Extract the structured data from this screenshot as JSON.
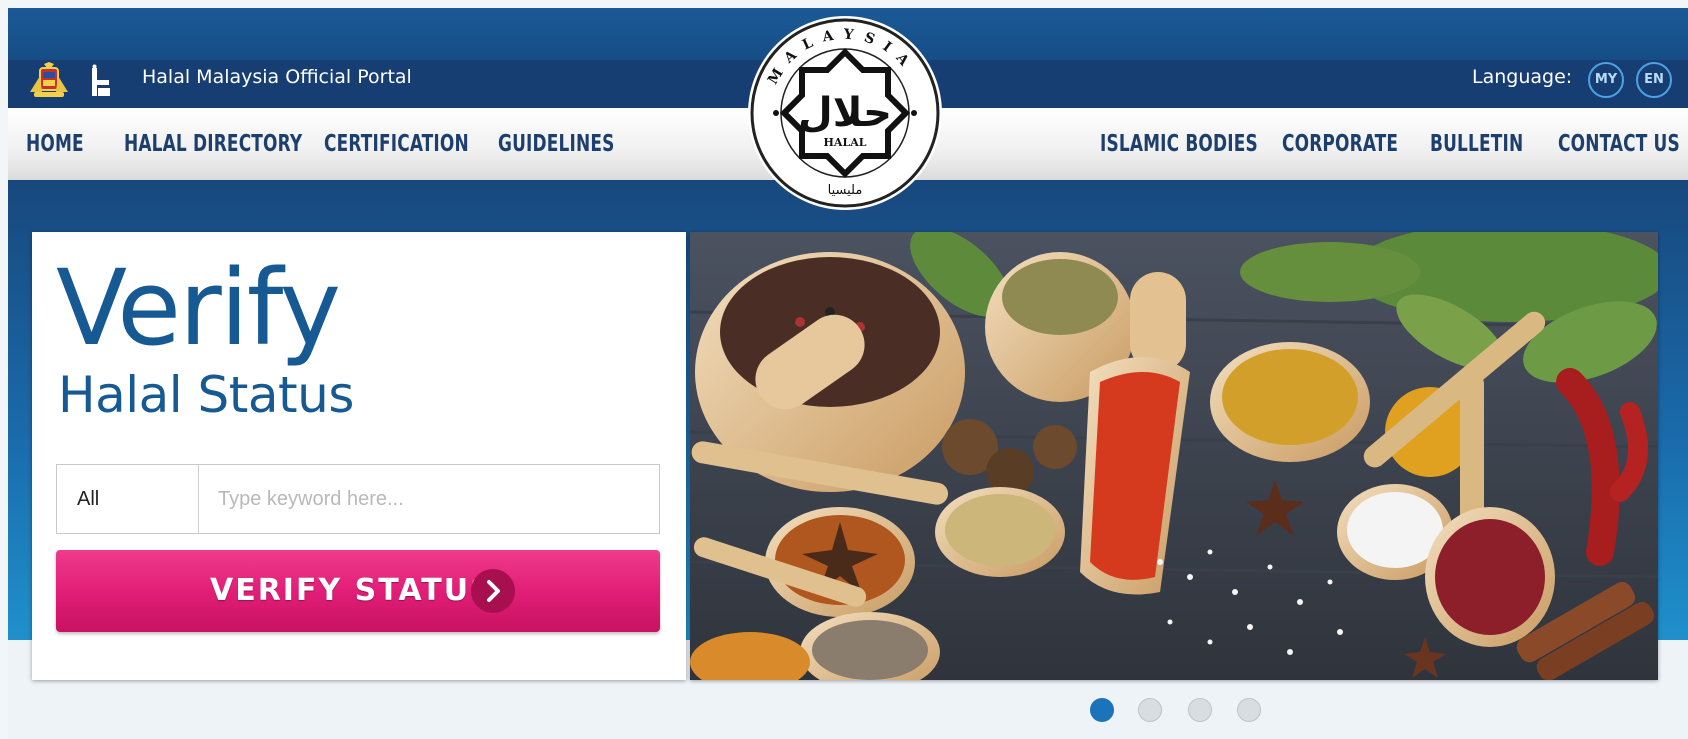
{
  "header": {
    "portal_title": "Halal Malaysia Official Portal",
    "language_label": "Language:",
    "languages": [
      "MY",
      "EN"
    ],
    "logo": {
      "ring_text": "MALAYSIA",
      "arabic_text": "حلال",
      "latin_text": "HALAL",
      "bottom_text": "مليسيا"
    }
  },
  "nav": {
    "left": [
      "HOME",
      "HALAL DIRECTORY",
      "CERTIFICATION",
      "GUIDELINES"
    ],
    "right": [
      "ISLAMIC BODIES",
      "CORPORATE",
      "BULLETIN",
      "CONTACT US"
    ]
  },
  "hero": {
    "title": "Verify",
    "subtitle": "Halal Status",
    "search": {
      "category": "All",
      "placeholder": "Type keyword here..."
    },
    "verify_button": "VERIFY STATUS",
    "image_name": "spices-photo",
    "slide_count": 4,
    "active_slide": 1
  },
  "colors": {
    "brand_blue": "#175a93",
    "nav_text": "#1c3f6e",
    "button_pink": "#e21e78",
    "active_dot": "#1b73b9"
  }
}
